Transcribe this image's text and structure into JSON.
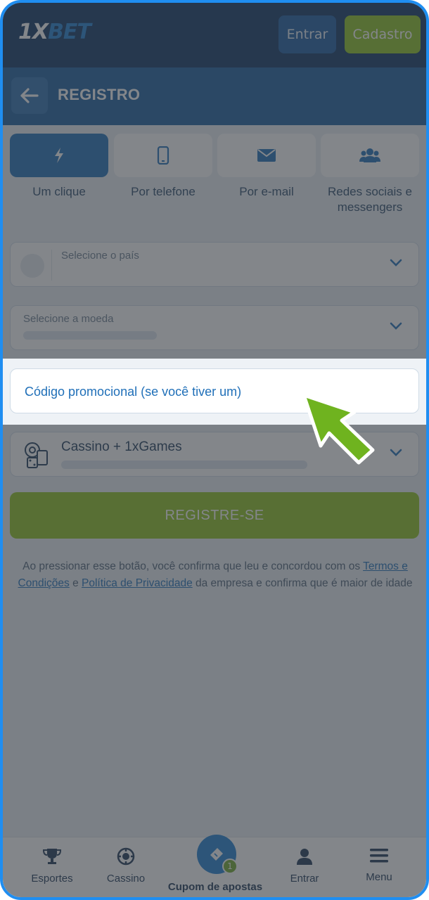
{
  "header": {
    "logo_one": "1X",
    "logo_bet": "BET",
    "login_label": "Entrar",
    "signup_label": "Cadastro"
  },
  "titlebar": {
    "title": "REGISTRO"
  },
  "tabs": [
    {
      "label": "Um clique",
      "icon": "lightning-icon",
      "active": true
    },
    {
      "label": "Por telefone",
      "icon": "phone-icon",
      "active": false
    },
    {
      "label": "Por e-mail",
      "icon": "envelope-icon",
      "active": false
    },
    {
      "label": "Redes sociais e messengers",
      "icon": "users-icon",
      "active": false
    }
  ],
  "form": {
    "country_label": "Selecione o país",
    "currency_label": "Selecione a moeda",
    "promo_placeholder": "Código promocional (se você tiver um)",
    "bonus_title": "Cassino + 1xGames",
    "register_label": "REGISTRE-SE"
  },
  "terms": {
    "part1": "Ao pressionar esse botão, você confirma que leu e concordou com os ",
    "link1": "Termos e Condições",
    "part2": " e ",
    "link2": "Política de Privacidade",
    "part3": " da empresa e confirma que é maior de idade"
  },
  "bottom_nav": {
    "sports": "Esportes",
    "casino": "Cassino",
    "coupon": "Cupom de apostas",
    "coupon_count": "1",
    "login": "Entrar",
    "menu": "Menu"
  },
  "colors": {
    "header": "#0d3461",
    "titlebar": "#195d9f",
    "accent_blue": "#1f6fb8",
    "accent_green": "#8ec21f",
    "highlight_arrow": "#6fb31f"
  }
}
